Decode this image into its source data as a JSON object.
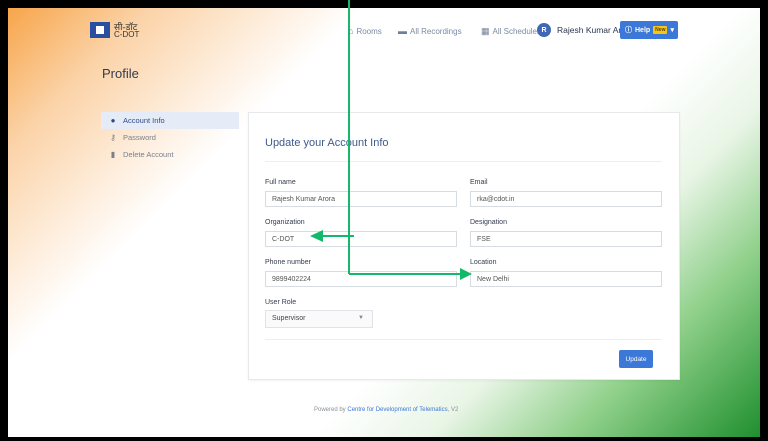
{
  "header": {
    "logo_hindi": "सी-डॉट",
    "logo_english": "C-DOT",
    "nav": [
      {
        "label": "Rooms",
        "icon": "home-icon"
      },
      {
        "label": "All Recordings",
        "icon": "video-icon"
      },
      {
        "label": "All Schedules",
        "icon": "calendar-icon"
      }
    ],
    "user_initial": "R",
    "user_name": "Rajesh Kumar Arora",
    "help_label": "Help",
    "help_badge": "New"
  },
  "page_title": "Profile",
  "sidebar": {
    "items": [
      {
        "label": "Account Info",
        "icon": "user-icon",
        "active": true
      },
      {
        "label": "Password",
        "icon": "key-icon",
        "active": false
      },
      {
        "label": "Delete Account",
        "icon": "trash-icon",
        "active": false
      }
    ]
  },
  "form": {
    "title": "Update your Account Info",
    "full_name_label": "Full name",
    "full_name_value": "Rajesh Kumar Arora",
    "email_label": "Email",
    "email_value": "rka@cdot.in",
    "organization_label": "Organization",
    "organization_value": "C-DOT",
    "designation_label": "Designation",
    "designation_value": "FSE",
    "phone_label": "Phone number",
    "phone_value": "9899402224",
    "location_label": "Location",
    "location_value": "New Delhi",
    "role_label": "User Role",
    "role_value": "Supervisor",
    "update_label": "Update"
  },
  "footer": {
    "prefix": "Powered by",
    "link": "Centre for Development of Telematics",
    "suffix": ", V2"
  },
  "colors": {
    "primary": "#3c78d8",
    "annotation_arrow": "#14b86a"
  }
}
